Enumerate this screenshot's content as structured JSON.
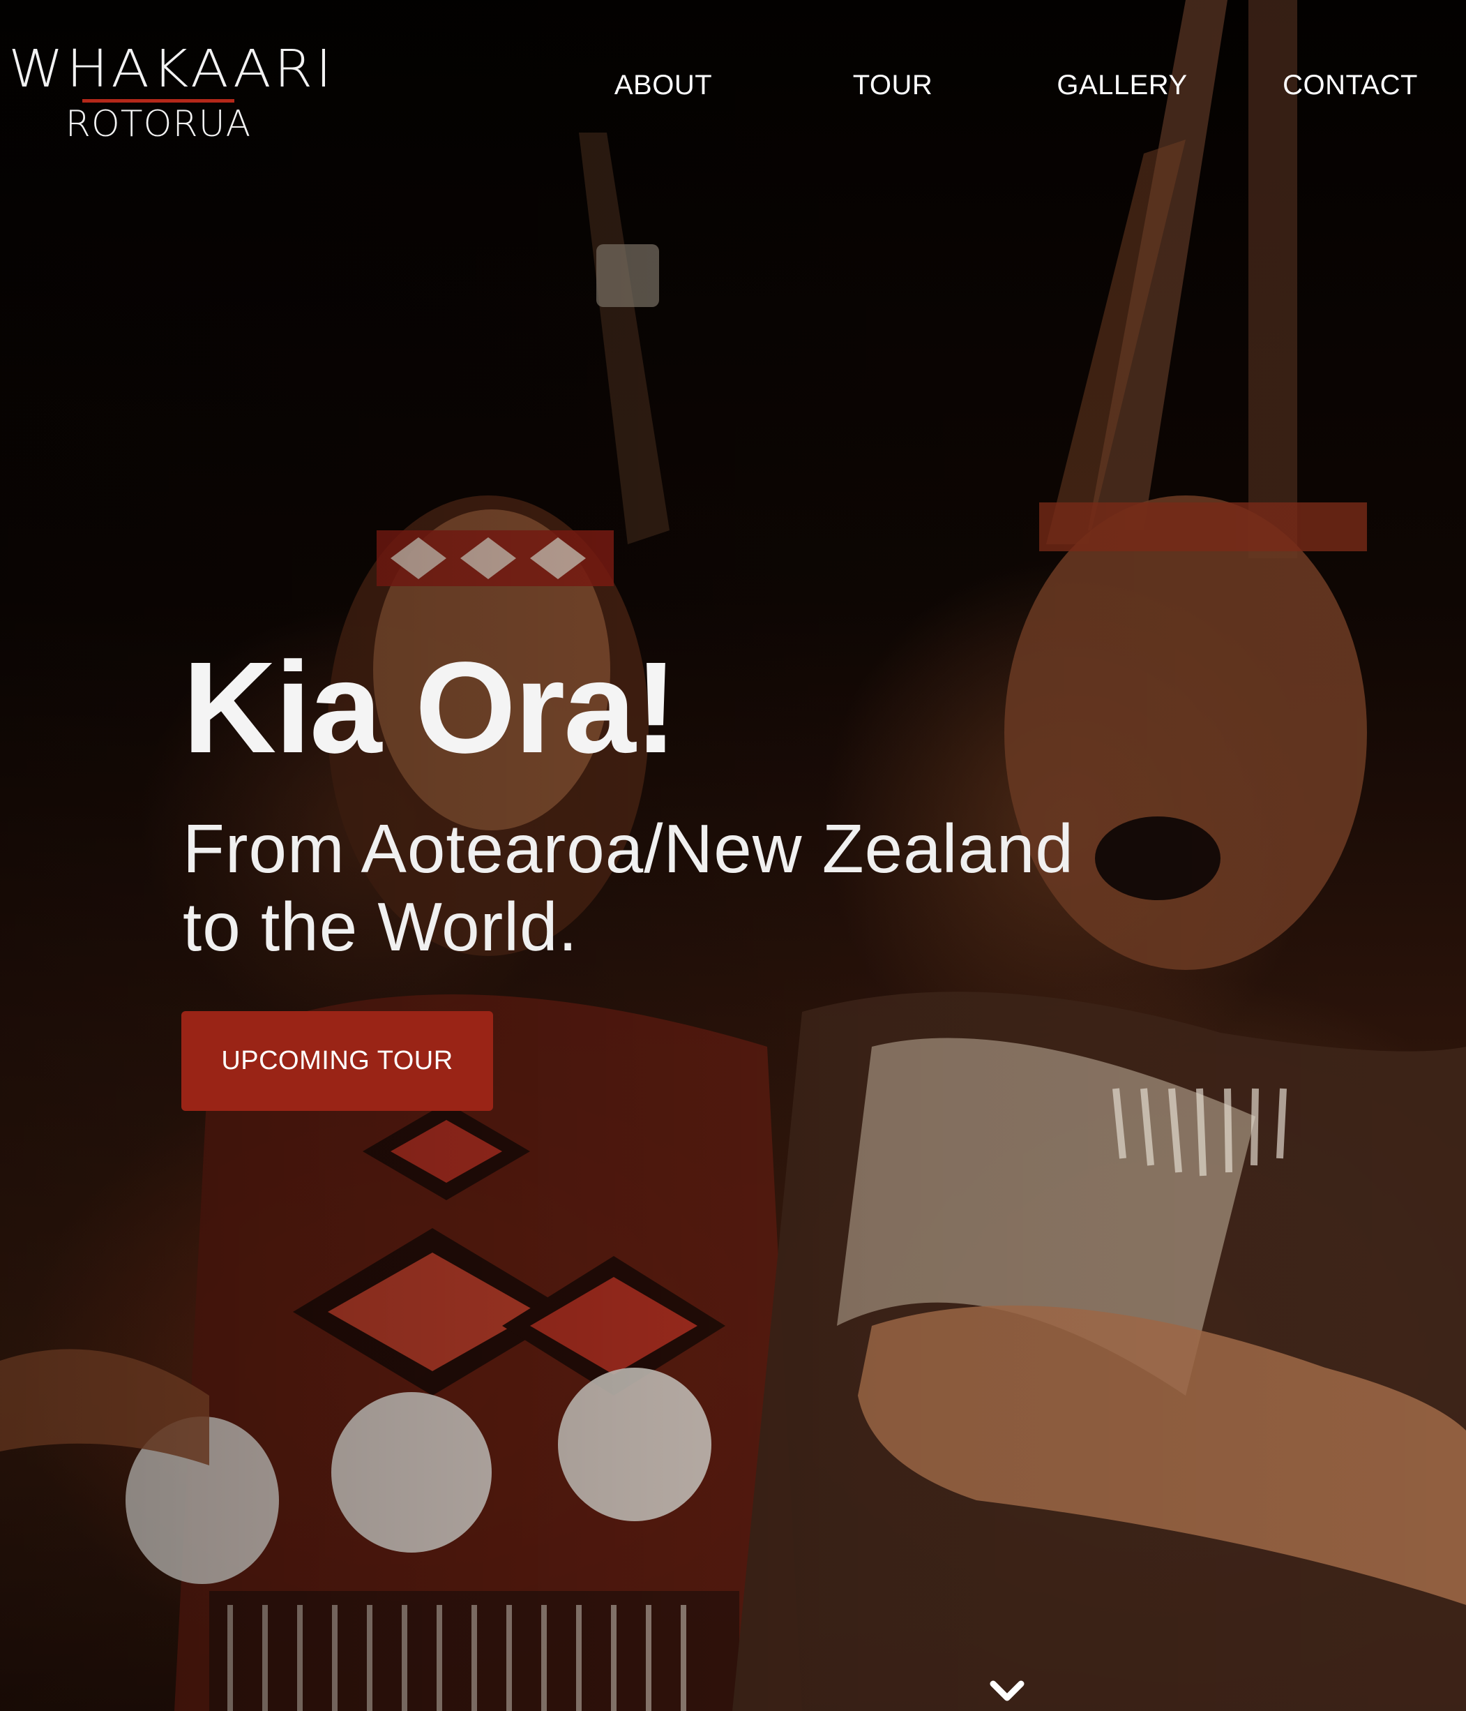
{
  "logo": {
    "main": "WHAKAARI",
    "sub": "ROTORUA"
  },
  "nav": {
    "items": [
      {
        "label": "ABOUT"
      },
      {
        "label": "TOUR"
      },
      {
        "label": "GALLERY"
      },
      {
        "label": "CONTACT"
      }
    ]
  },
  "hero": {
    "title": "Kia Ora!",
    "subtitle_line1": "From Aotearoa/New Zealand",
    "subtitle_line2": "to the World.",
    "cta_label": "UPCOMING TOUR",
    "scroll_icon": "chevron-down-icon"
  },
  "colors": {
    "accent": "#9a2416",
    "logo_rule": "#b4281a",
    "text": "#ffffff"
  }
}
